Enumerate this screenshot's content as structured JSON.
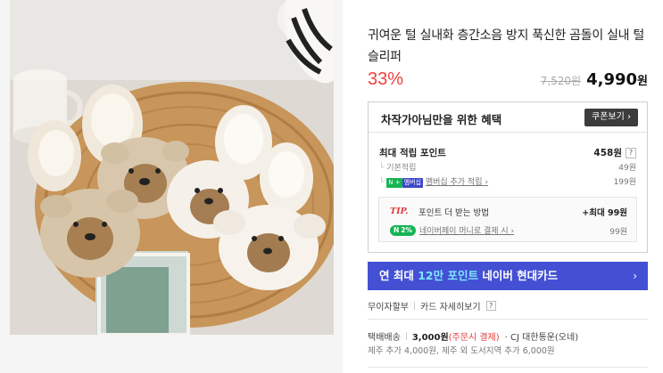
{
  "product": {
    "title": "귀여운 털 실내화 층간소음 방지 푹신한 곰돌이 실내 털 슬리퍼",
    "discount_rate": "33%",
    "original_price": "7,520원",
    "sale_price": "4,990",
    "sale_unit": "원",
    "image_alt": "곰돌이 털 슬리퍼 사진"
  },
  "benefits": {
    "title": "차작가아님만을 위한 혜택",
    "coupon_button": "쿠폰보기 ›",
    "max_points_label": "최대 적립 포인트",
    "max_points_value": "458원",
    "help_mark": "?",
    "basic_label": "기본적립",
    "basic_value": "49원",
    "membership_badge_n": "N +",
    "membership_badge": "멤버십",
    "membership_label": "멤버십 추가 적립 ›",
    "membership_value": "199원",
    "tip_mark": "TIP.",
    "tip_text": "포인트 더 받는 방법",
    "tip_max": "+최대 99원",
    "pay_badge": "2%",
    "pay_label": "네이버페이 머니로 결제 시 ›",
    "pay_value": "99원"
  },
  "card_banner": {
    "prefix": "연 최대 ",
    "highlight": "12만 포인트",
    "suffix": " 네이버 현대카드",
    "arrow": "›"
  },
  "payment": {
    "installment": "무이자할부",
    "card_detail": "카드 자세히보기",
    "help_mark": "?"
  },
  "shipping": {
    "label": "택배배송",
    "price": "3,000원",
    "pay_note": "(주문시 결제)",
    "carrier": "· CJ 대한통운(오네)",
    "extra": "제주 추가 4,000원, 제주 외 도서지역 추가 6,000원"
  },
  "colors": {
    "discount": "#f0403a",
    "card_banner": "#4350d4",
    "card_highlight": "#7fe4ff",
    "naver_green": "#17b455"
  }
}
